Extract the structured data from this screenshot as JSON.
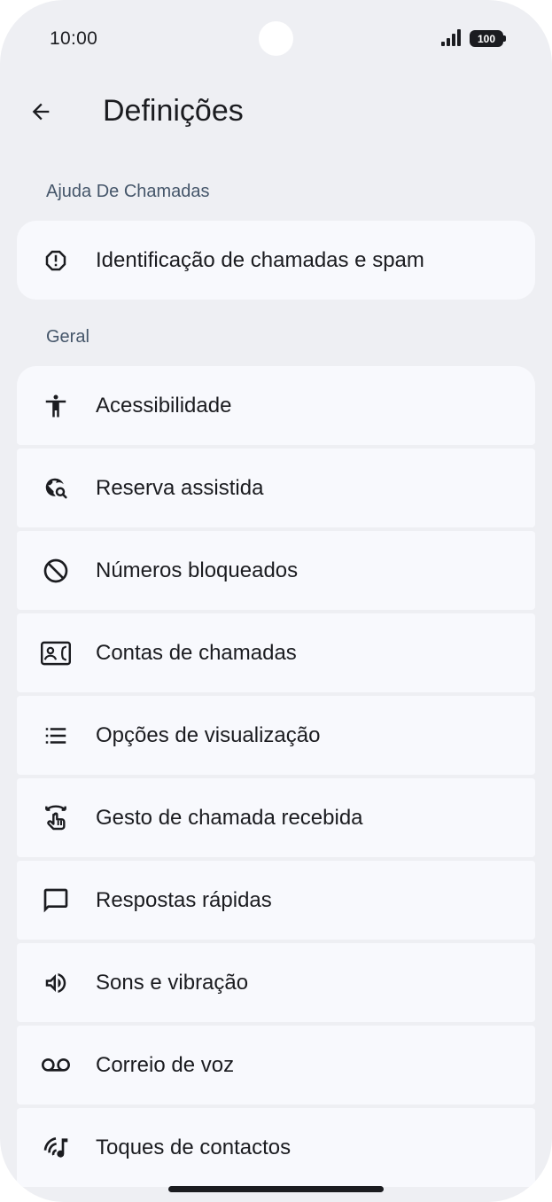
{
  "status_bar": {
    "time": "10:00",
    "battery": "100"
  },
  "app_bar": {
    "title": "Definições",
    "back_icon": "arrow-back-icon"
  },
  "sections": [
    {
      "header": "Ajuda De Chamadas",
      "items": [
        {
          "label": "Identificação de chamadas e spam",
          "icon": "report-octagon-icon"
        }
      ]
    },
    {
      "header": "Geral",
      "items": [
        {
          "label": "Acessibilidade",
          "icon": "accessibility-icon"
        },
        {
          "label": "Reserva assistida",
          "icon": "travel-explore-icon"
        },
        {
          "label": "Números bloqueados",
          "icon": "block-icon"
        },
        {
          "label": "Contas de chamadas",
          "icon": "contact-phone-icon"
        },
        {
          "label": "Opções de visualização",
          "icon": "list-icon"
        },
        {
          "label": "Gesto de chamada recebida",
          "icon": "swipe-gesture-icon"
        },
        {
          "label": "Respostas rápidas",
          "icon": "chat-bubble-icon"
        },
        {
          "label": "Sons e vibração",
          "icon": "volume-icon"
        },
        {
          "label": "Correio de voz",
          "icon": "voicemail-icon"
        },
        {
          "label": "Toques de contactos",
          "icon": "ringtone-icon"
        }
      ]
    }
  ],
  "colors": {
    "background": "#eeeff3",
    "card": "#f8f9fd",
    "text": "#1b1c20",
    "section_header": "#45566a"
  }
}
